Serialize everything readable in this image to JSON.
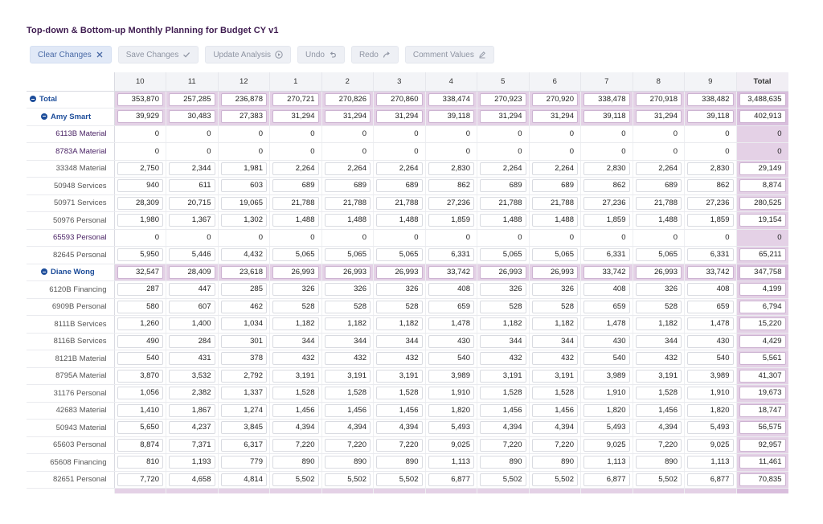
{
  "title": "Top-down & Bottom-up Monthly Planning for Budget CY v1",
  "toolbar": [
    {
      "label": "Clear Changes",
      "icon": "close-icon",
      "primary": true
    },
    {
      "label": "Save Changes",
      "icon": "check-icon",
      "primary": false
    },
    {
      "label": "Update Analysis",
      "icon": "play-circle-icon",
      "primary": false
    },
    {
      "label": "Undo",
      "icon": "undo-icon",
      "primary": false
    },
    {
      "label": "Redo",
      "icon": "redo-icon",
      "primary": false
    },
    {
      "label": "Comment Values",
      "icon": "pencil-icon",
      "primary": false
    }
  ],
  "columns": [
    "10",
    "11",
    "12",
    "1",
    "2",
    "3",
    "4",
    "5",
    "6",
    "7",
    "8",
    "9",
    "Total"
  ],
  "rows": [
    {
      "label": "Total",
      "level": 0,
      "group": true,
      "editable": true,
      "values": [
        "353,870",
        "257,285",
        "236,878",
        "270,721",
        "270,826",
        "270,860",
        "338,474",
        "270,923",
        "270,920",
        "338,478",
        "270,918",
        "338,482",
        "3,488,635"
      ]
    },
    {
      "label": "Amy Smart",
      "level": 1,
      "group": true,
      "editable": true,
      "values": [
        "39,929",
        "30,483",
        "27,383",
        "31,294",
        "31,294",
        "31,294",
        "39,118",
        "31,294",
        "31,294",
        "39,118",
        "31,294",
        "39,118",
        "402,913"
      ]
    },
    {
      "label": "6113B Material",
      "level": 2,
      "muted": true,
      "editable": false,
      "values": [
        "0",
        "0",
        "0",
        "0",
        "0",
        "0",
        "0",
        "0",
        "0",
        "0",
        "0",
        "0",
        "0"
      ]
    },
    {
      "label": "8783A Material",
      "level": 2,
      "muted": true,
      "editable": false,
      "values": [
        "0",
        "0",
        "0",
        "0",
        "0",
        "0",
        "0",
        "0",
        "0",
        "0",
        "0",
        "0",
        "0"
      ]
    },
    {
      "label": "33348 Material",
      "level": 2,
      "editable": true,
      "values": [
        "2,750",
        "2,344",
        "1,981",
        "2,264",
        "2,264",
        "2,264",
        "2,830",
        "2,264",
        "2,264",
        "2,830",
        "2,264",
        "2,830",
        "29,149"
      ]
    },
    {
      "label": "50948 Services",
      "level": 2,
      "editable": true,
      "values": [
        "940",
        "611",
        "603",
        "689",
        "689",
        "689",
        "862",
        "689",
        "689",
        "862",
        "689",
        "862",
        "8,874"
      ]
    },
    {
      "label": "50971 Services",
      "level": 2,
      "editable": true,
      "values": [
        "28,309",
        "20,715",
        "19,065",
        "21,788",
        "21,788",
        "21,788",
        "27,236",
        "21,788",
        "21,788",
        "27,236",
        "21,788",
        "27,236",
        "280,525"
      ]
    },
    {
      "label": "50976 Personal",
      "level": 2,
      "editable": true,
      "values": [
        "1,980",
        "1,367",
        "1,302",
        "1,488",
        "1,488",
        "1,488",
        "1,859",
        "1,488",
        "1,488",
        "1,859",
        "1,488",
        "1,859",
        "19,154"
      ]
    },
    {
      "label": "65593 Personal",
      "level": 2,
      "muted": true,
      "editable": false,
      "values": [
        "0",
        "0",
        "0",
        "0",
        "0",
        "0",
        "0",
        "0",
        "0",
        "0",
        "0",
        "0",
        "0"
      ]
    },
    {
      "label": "82645 Personal",
      "level": 2,
      "editable": true,
      "values": [
        "5,950",
        "5,446",
        "4,432",
        "5,065",
        "5,065",
        "5,065",
        "6,331",
        "5,065",
        "5,065",
        "6,331",
        "5,065",
        "6,331",
        "65,211"
      ]
    },
    {
      "label": "Diane Wong",
      "level": 1,
      "group": true,
      "editable": true,
      "values": [
        "32,547",
        "28,409",
        "23,618",
        "26,993",
        "26,993",
        "26,993",
        "33,742",
        "26,993",
        "26,993",
        "33,742",
        "26,993",
        "33,742",
        "347,758"
      ]
    },
    {
      "label": "6120B Financing",
      "level": 2,
      "editable": true,
      "values": [
        "287",
        "447",
        "285",
        "326",
        "326",
        "326",
        "408",
        "326",
        "326",
        "408",
        "326",
        "408",
        "4,199"
      ]
    },
    {
      "label": "6909B Personal",
      "level": 2,
      "editable": true,
      "values": [
        "580",
        "607",
        "462",
        "528",
        "528",
        "528",
        "659",
        "528",
        "528",
        "659",
        "528",
        "659",
        "6,794"
      ]
    },
    {
      "label": "8111B Services",
      "level": 2,
      "editable": true,
      "values": [
        "1,260",
        "1,400",
        "1,034",
        "1,182",
        "1,182",
        "1,182",
        "1,478",
        "1,182",
        "1,182",
        "1,478",
        "1,182",
        "1,478",
        "15,220"
      ]
    },
    {
      "label": "8116B Services",
      "level": 2,
      "editable": true,
      "values": [
        "490",
        "284",
        "301",
        "344",
        "344",
        "344",
        "430",
        "344",
        "344",
        "430",
        "344",
        "430",
        "4,429"
      ]
    },
    {
      "label": "8121B Material",
      "level": 2,
      "editable": true,
      "values": [
        "540",
        "431",
        "378",
        "432",
        "432",
        "432",
        "540",
        "432",
        "432",
        "540",
        "432",
        "540",
        "5,561"
      ]
    },
    {
      "label": "8795A Material",
      "level": 2,
      "editable": true,
      "values": [
        "3,870",
        "3,532",
        "2,792",
        "3,191",
        "3,191",
        "3,191",
        "3,989",
        "3,191",
        "3,191",
        "3,989",
        "3,191",
        "3,989",
        "41,307"
      ]
    },
    {
      "label": "31176 Personal",
      "level": 2,
      "editable": true,
      "values": [
        "1,056",
        "2,382",
        "1,337",
        "1,528",
        "1,528",
        "1,528",
        "1,910",
        "1,528",
        "1,528",
        "1,910",
        "1,528",
        "1,910",
        "19,673"
      ]
    },
    {
      "label": "42683 Material",
      "level": 2,
      "editable": true,
      "values": [
        "1,410",
        "1,867",
        "1,274",
        "1,456",
        "1,456",
        "1,456",
        "1,820",
        "1,456",
        "1,456",
        "1,820",
        "1,456",
        "1,820",
        "18,747"
      ]
    },
    {
      "label": "50943 Material",
      "level": 2,
      "editable": true,
      "values": [
        "5,650",
        "4,237",
        "3,845",
        "4,394",
        "4,394",
        "4,394",
        "5,493",
        "4,394",
        "4,394",
        "5,493",
        "4,394",
        "5,493",
        "56,575"
      ]
    },
    {
      "label": "65603 Personal",
      "level": 2,
      "editable": true,
      "values": [
        "8,874",
        "7,371",
        "6,317",
        "7,220",
        "7,220",
        "7,220",
        "9,025",
        "7,220",
        "7,220",
        "9,025",
        "7,220",
        "9,025",
        "92,957"
      ]
    },
    {
      "label": "65608 Financing",
      "level": 2,
      "editable": true,
      "values": [
        "810",
        "1,193",
        "779",
        "890",
        "890",
        "890",
        "1,113",
        "890",
        "890",
        "1,113",
        "890",
        "1,113",
        "11,461"
      ]
    },
    {
      "label": "82651 Personal",
      "level": 2,
      "editable": true,
      "values": [
        "7,720",
        "4,658",
        "4,814",
        "5,502",
        "5,502",
        "5,502",
        "6,877",
        "5,502",
        "5,502",
        "6,877",
        "5,502",
        "6,877",
        "70,835"
      ]
    }
  ],
  "colors": {
    "title": "#3d1a4f",
    "group_label": "#1d4d9a",
    "highlight": "#e4d1e6"
  }
}
